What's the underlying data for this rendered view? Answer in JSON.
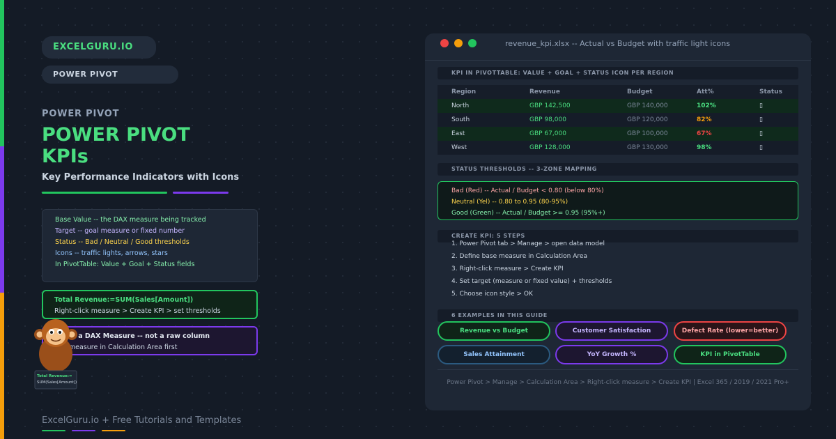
{
  "colors": {
    "green": "#22c55e",
    "purple": "#7c3aed",
    "orange": "#f59e0b",
    "red": "#ef4444"
  },
  "left": {
    "brand": "EXCELGURU.IO",
    "topic": "POWER PIVOT",
    "eyebrow": "POWER PIVOT",
    "title_line1": "POWER PIVOT",
    "title_line2": "KPIs",
    "subtitle": "Key Performance Indicators with Icons",
    "definitions": [
      "Base Value -- the DAX measure being tracked",
      "Target -- goal measure or fixed number",
      "Status -- Bad / Neutral / Good thresholds",
      "Icons -- traffic lights, arrows, stars",
      "In PivotTable: Value + Goal + Status fields"
    ],
    "formula_line1": "Total Revenue:=SUM(Sales[Amount])",
    "formula_line2": "Right-click measure > Create KPI > set thresholds",
    "needs_line1": "eds a DAX Measure -- not a raw column",
    "needs_line2": "e measure in Calculation Area first",
    "mascot_card_line1": "Total Revenue:=",
    "mascot_card_line2": "SUM(Sales[Amount])",
    "footer": "ExcelGuru.io + Free Tutorials and Templates"
  },
  "window": {
    "title": "revenue_kpi.xlsx -- Actual vs Budget with traffic light icons",
    "section_kpi": "KPI IN PIVOTTABLE: VALUE + GOAL + STATUS ICON PER REGION",
    "table": {
      "headers": [
        "Region",
        "Revenue",
        "Budget",
        "Att%",
        "Status"
      ],
      "rows": [
        {
          "region": "North",
          "revenue": "GBP 142,500",
          "budget": "GBP 140,000",
          "att": "102%",
          "att_color": "#4ade80",
          "status_icon": "traffic-light-green",
          "status_glyph": "▯"
        },
        {
          "region": "South",
          "revenue": "GBP 98,000",
          "budget": "GBP 120,000",
          "att": "82%",
          "att_color": "#f59e0b",
          "status_icon": "traffic-light-yellow",
          "status_glyph": "▯"
        },
        {
          "region": "East",
          "revenue": "GBP 67,000",
          "budget": "GBP 100,000",
          "att": "67%",
          "att_color": "#ef4444",
          "status_icon": "traffic-light-red",
          "status_glyph": "▯"
        },
        {
          "region": "West",
          "revenue": "GBP 128,000",
          "budget": "GBP 130,000",
          "att": "98%",
          "att_color": "#4ade80",
          "status_icon": "traffic-light-green",
          "status_glyph": "▯"
        }
      ]
    },
    "section_thresholds": "STATUS THRESHOLDS -- 3-ZONE MAPPING",
    "thresholds": [
      {
        "text": "Bad (Red) -- Actual / Budget < 0.80 (below 80%)",
        "color": "#fca5a5"
      },
      {
        "text": "Neutral (Yel) -- 0.80 to 0.95 (80-95%)",
        "color": "#fcd34d"
      },
      {
        "text": "Good (Green) -- Actual / Budget >= 0.95 (95%+)",
        "color": "#86efac"
      }
    ],
    "section_steps": "CREATE KPI: 5 STEPS",
    "steps": [
      "1. Power Pivot tab > Manage > open data model",
      "2. Define base measure in Calculation Area",
      "3. Right-click measure > Create KPI",
      "4. Set target (measure or fixed value) + thresholds",
      "5. Choose icon style > OK"
    ],
    "section_examples": "6 EXAMPLES IN THIS GUIDE",
    "examples": [
      "Revenue vs Budget",
      "Customer Satisfaction",
      "Defect Rate (lower=better)",
      "Sales Attainment",
      "YoY Growth %",
      "KPI in PivotTable"
    ],
    "footer": "Power Pivot > Manage > Calculation Area > Right-click measure > Create KPI | Excel 365 / 2019 / 2021 Pro+"
  }
}
